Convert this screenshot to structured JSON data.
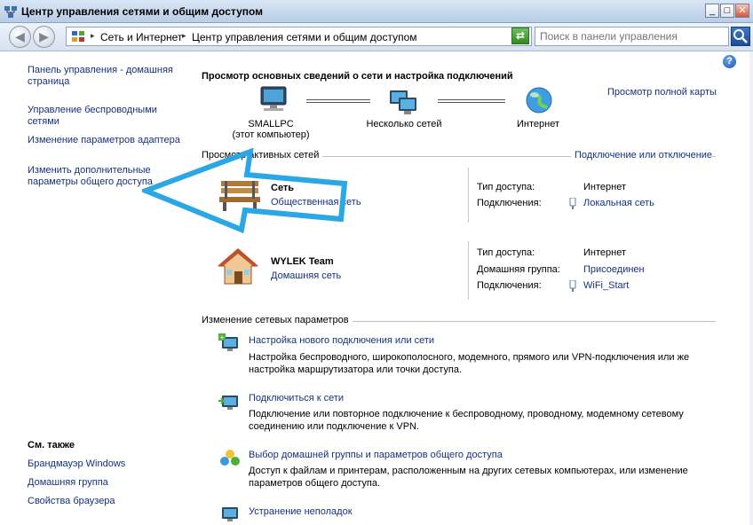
{
  "window": {
    "title": "Центр управления сетями и общим доступом",
    "minimize": "_",
    "maximize": "□",
    "close": "✕"
  },
  "address": {
    "segments": [
      "Сеть и Интернет",
      "Центр управления сетями и общим доступом"
    ]
  },
  "search": {
    "placeholder": "Поиск в панели управления"
  },
  "left_nav": {
    "links": [
      "Панель управления - домашняя страница",
      "Управление беспроводными сетями",
      "Изменение параметров адаптера",
      "Изменить дополнительные параметры общего доступа"
    ],
    "see_also_title": "См. также",
    "see_also": [
      "Брандмауэр Windows",
      "Домашняя группа",
      "Свойства браузера"
    ]
  },
  "main": {
    "heading": "Просмотр основных сведений о сети и настройка подключений",
    "full_map_link": "Просмотр полной карты",
    "map": {
      "node1_line1": "SMALLPC",
      "node1_line2": "(этот компьютер)",
      "node2": "Несколько сетей",
      "node3": "Интернет"
    },
    "active_networks_title": "Просмотр активных сетей",
    "connect_disconnect_link": "Подключение или отключение",
    "networks": [
      {
        "name": "Сеть",
        "type": "Общественная сеть",
        "access_label": "Тип доступа:",
        "access_value": "Интернет",
        "conn_label": "Подключения:",
        "conn_value": "Локальная сеть"
      },
      {
        "name": "WYLEK Team",
        "type": "Домашняя сеть",
        "access_label": "Тип доступа:",
        "access_value": "Интернет",
        "homegroup_label": "Домашняя группа:",
        "homegroup_value": "Присоединен",
        "conn_label": "Подключения:",
        "conn_value": "WiFi_Start"
      }
    ],
    "change_settings_title": "Изменение сетевых параметров",
    "tasks": [
      {
        "title": "Настройка нового подключения или сети",
        "desc": "Настройка беспроводного, широкополосного, модемного, прямого или VPN-подключения или же настройка маршрутизатора или точки доступа."
      },
      {
        "title": "Подключиться к сети",
        "desc": "Подключение или повторное подключение к беспроводному, проводному, модемному сетевому соединению или подключение к VPN."
      },
      {
        "title": "Выбор домашней группы и параметров общего доступа",
        "desc": "Доступ к файлам и принтерам, расположенным на других сетевых компьютерах, или изменение параметров общего доступа."
      },
      {
        "title": "Устранение неполадок",
        "desc": ""
      }
    ]
  },
  "icons": {
    "title": "network-center-icon",
    "back": "back-arrow-icon",
    "forward": "forward-arrow-icon",
    "address": "control-panel-icon",
    "refresh": "refresh-icon",
    "search": "search-icon",
    "help": "help-icon",
    "computer": "computer-icon",
    "networks": "networks-icon",
    "internet": "globe-icon",
    "bench": "bench-icon",
    "house": "house-icon",
    "plug": "plug-icon",
    "annotation": "annotation-arrow-icon"
  },
  "colors": {
    "link": "#15317e",
    "arrow": "#2aa7e4",
    "titlebar": "#c6d8ee"
  }
}
